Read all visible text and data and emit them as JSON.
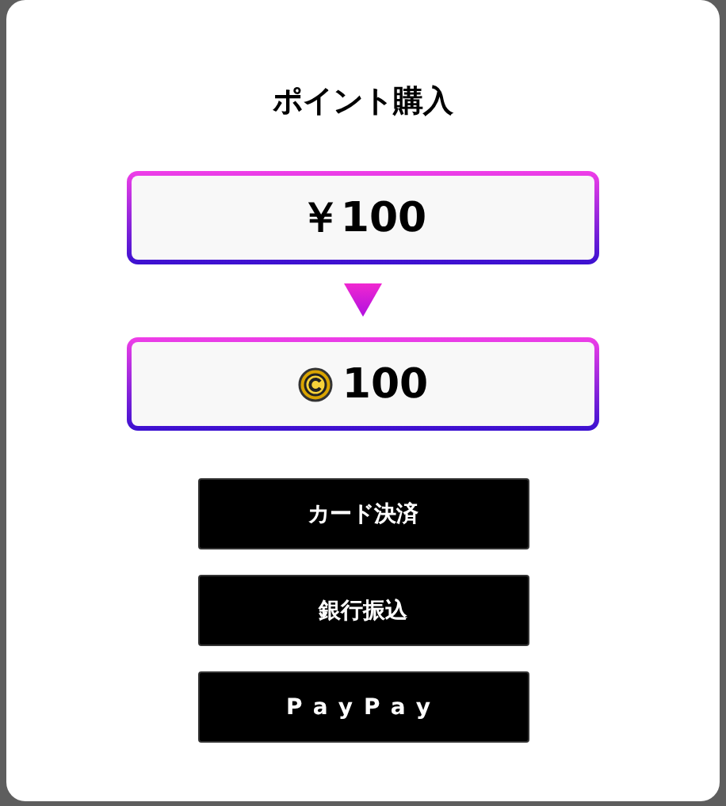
{
  "dialog": {
    "title": "ポイント購入",
    "price": "￥100",
    "points": "100",
    "payment_buttons": [
      {
        "label": "カード決済",
        "kind": "plain"
      },
      {
        "label": "銀行振込",
        "kind": "plain"
      },
      {
        "label": "PayPay",
        "kind": "spaced"
      }
    ]
  }
}
